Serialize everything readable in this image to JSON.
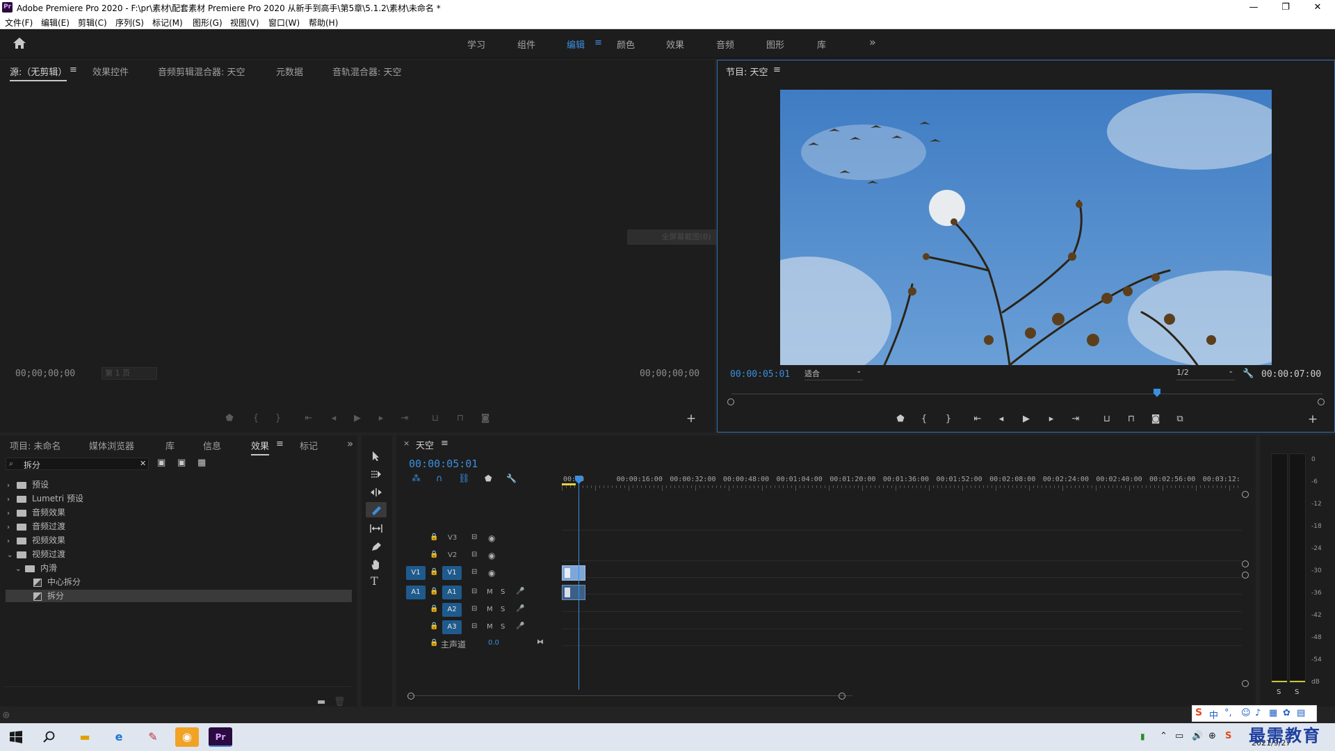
{
  "window": {
    "title": "Adobe Premiere Pro 2020 - F:\\pr\\素材\\配套素材 Premiere Pro 2020 从新手到高手\\第5章\\5.1.2\\素材\\未命名 *",
    "logo": "Pr",
    "minimize": "—",
    "restore": "❐",
    "close": "✕"
  },
  "menu": [
    "文件(F)",
    "编辑(E)",
    "剪辑(C)",
    "序列(S)",
    "标记(M)",
    "图形(G)",
    "视图(V)",
    "窗口(W)",
    "帮助(H)"
  ],
  "workspaces": {
    "items": [
      "学习",
      "组件",
      "编辑",
      "颜色",
      "效果",
      "音频",
      "图形",
      "库"
    ],
    "active": "编辑",
    "menu_icon": "≡",
    "more": "»"
  },
  "source_panel": {
    "tabs": [
      "源:（无剪辑）",
      "效果控件",
      "音频剪辑混合器: 天空",
      "元数据",
      "音轨混合器: 天空"
    ],
    "menu_icon": "≡",
    "timecode_left": "00;00;00;00",
    "page_select": "第 1 页",
    "timecode_right": "00;00;00;00",
    "overlay_hint": "全屏幕截图(B)"
  },
  "program_panel": {
    "title": "节目: 天空",
    "menu_icon": "≡",
    "timecode": "00:00:05:01",
    "fit": "适合",
    "resolution": "1/2",
    "duration": "00:00:07:00",
    "playhead_fraction": 0.72
  },
  "project_panel": {
    "tabs": [
      "项目: 未命名",
      "媒体浏览器",
      "库",
      "信息",
      "效果",
      "标记"
    ],
    "active_tab": "效果",
    "more": "»",
    "menu_icon": "≡",
    "search_value": "拆分",
    "clear": "✕",
    "tree": [
      {
        "label": "预设",
        "type": "folder",
        "level": 0,
        "expanded": false
      },
      {
        "label": "Lumetri 预设",
        "type": "folder",
        "level": 0,
        "expanded": false
      },
      {
        "label": "音频效果",
        "type": "folder",
        "level": 0,
        "expanded": false
      },
      {
        "label": "音频过渡",
        "type": "folder",
        "level": 0,
        "expanded": false
      },
      {
        "label": "视频效果",
        "type": "folder",
        "level": 0,
        "expanded": false
      },
      {
        "label": "视频过渡",
        "type": "folder",
        "level": 0,
        "expanded": true
      },
      {
        "label": "内滑",
        "type": "folder",
        "level": 1,
        "expanded": true
      },
      {
        "label": "中心拆分",
        "type": "item",
        "level": 2
      },
      {
        "label": "拆分",
        "type": "item",
        "level": 2,
        "selected": true
      }
    ]
  },
  "tools": [
    "selection-tool",
    "track-select-tool",
    "ripple-edit-tool",
    "razor-tool",
    "slip-tool",
    "pen-tool",
    "hand-tool",
    "type-tool"
  ],
  "timeline": {
    "sequence_name": "天空",
    "close": "×",
    "menu_icon": "≡",
    "timecode": "00:00:05:01",
    "ruler": [
      "00:00",
      "00:00:16:00",
      "00:00:32:00",
      "00:00:48:00",
      "00:01:04:00",
      "00:01:20:00",
      "00:01:36:00",
      "00:01:52:00",
      "00:02:08:00",
      "00:02:24:00",
      "00:02:40:00",
      "00:02:56:00",
      "00:03:12:"
    ],
    "video_tracks": [
      "V3",
      "V2",
      "V1"
    ],
    "audio_tracks": [
      "A1",
      "A2",
      "A3"
    ],
    "source_video": "V1",
    "source_audio": "A1",
    "mute": "M",
    "solo": "S",
    "master": "主声道",
    "master_value": "0.0"
  },
  "meter": {
    "scale": [
      "0",
      "-6",
      "-12",
      "-18",
      "-24",
      "-30",
      "-36",
      "-42",
      "-48",
      "-54",
      "dB"
    ],
    "solo_left": "S",
    "solo_right": "S"
  },
  "taskbar": {
    "date": "2021/9/27",
    "ime": "中",
    "watermark": "最需教育"
  },
  "colors": {
    "accent": "#3a8fe0",
    "panel": "#1d1d1d",
    "frame": "#232323",
    "track_target": "#1f5a8c",
    "clip": "#7ea7d8"
  }
}
